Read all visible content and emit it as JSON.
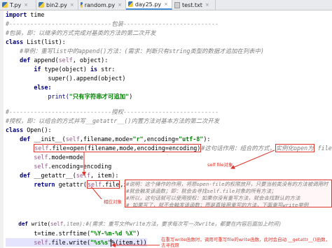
{
  "tabs": [
    {
      "label": "T.py",
      "icon": "python-file-icon",
      "active": false
    },
    {
      "label": "bin2.py",
      "icon": "python-file-icon",
      "active": false
    },
    {
      "label": "random.py",
      "icon": "python-file-icon",
      "active": false
    },
    {
      "label": "day25.py",
      "icon": "python-file-icon",
      "active": true
    },
    {
      "label": "test.txt",
      "icon": "text-file-icon",
      "active": false
    }
  ],
  "close_glyph": "×",
  "code": {
    "l1a": "import",
    "l1b": " time",
    "l2": "#-----------------------------包装---------------------------",
    "l3": "#包装，即：以继承的方式完成对基类的方法的第二次开发",
    "l4a": "class",
    "l4b": " List(list):",
    "l5": "    #举例：重写list中的append()方法：(需求：判断只有string类型的数据才追加在列表中)",
    "l6a": "    def",
    "l6b": " append(",
    "l6c": "self",
    "l6d": ", object):",
    "l7a": "        if",
    "l7b": " type(object) ",
    "l7c": "is",
    "l7d": " str:",
    "l8a": "            super().append(object)",
    "l9a": "        else:",
    "l10a": "            print(",
    "l10b": "\"只有字符串才可追加\"",
    "l10c": ")",
    "l11": "#-----------------------------授权---------------------------",
    "l12": "#授权，即：以组合的方式并写__getattr__()内置方法对基本方法的第二次开发",
    "l13a": "class",
    "l13b": " Open():",
    "l14a": "    def",
    "l14b": " __init__(",
    "l14c": "self",
    "l14d": ",filename,mode=",
    "l14e": "\"r\"",
    "l14f": ",encoding=",
    "l14g": "\"utf-8\"",
    "l14h": "):",
    "l15a": "        ",
    "l15b": "self",
    "l15c": ".file=open(filename,mode,encoding=encoding)",
    "l15d": "#这句话作用：组合的方式，",
    "l15e": "实例化open为",
    "l15f": " file;",
    "l16a": "        ",
    "l16b": "self",
    "l16c": ".mode=mode",
    "l17a": "        ",
    "l17b": "self",
    "l17c": ".encoding=encoding",
    "l18a": "    def",
    "l18b": " __getattr__(",
    "l18c": "self",
    "l18d": ", item):",
    "l19a": "        return",
    "l19b": " getattr(",
    "l19c": "self",
    "l19d": ".file",
    "l19e": ",item)",
    "l19f": "#说明：这个操作的作用，将原open-file的权限放开，只要当前类没有的方法被调用时",
    "l20": "#就会触发该函数；即：就会去寻找self.file对象的所有方法；",
    "l21": "#所以，这句话就可以使用授权：如果你没有重写方法，就会去找默认的方法",
    "l22": "# 如果写了，就不会触发该函数；而是直接用重写的方法，下面重写write举例",
    "l24a": "    def",
    "l24b": " write(",
    "l24c": "self",
    "l24d": ",item):#(需求：重写文件write方法，要求每次写一次write，都要在内容后面加上时间)",
    "l25a": "        t=time.strftime(",
    "l25b": "\"%Y-%m-%d %X\"",
    "l25c": ")",
    "l26a": "        ",
    "l26b": "self",
    "l26c": ".file.write(",
    "l26d": "\"%s%s\"",
    "l26e": "%(item,t))"
  },
  "annotations": {
    "file_object": "self file对象",
    "equivalent": "相应对象",
    "bottom": "在重写write函数时，调用可重写file的write函数，此时会自动 __getattr__()函数，去寻找原"
  },
  "colors": {
    "accent": "#e0332b",
    "keyword": "#000080",
    "comment": "#808080",
    "string": "#008000",
    "self": "#94558d",
    "active_tab": "#4a90d9"
  }
}
